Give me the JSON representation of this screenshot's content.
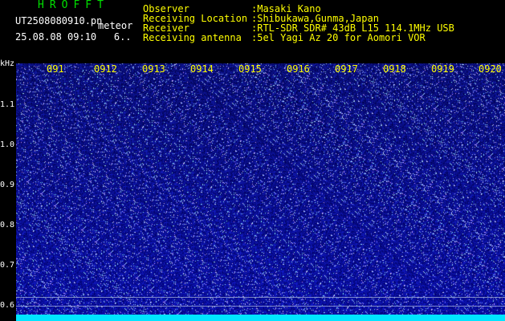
{
  "header": {
    "app_title": "HROFFT",
    "file_name": "UT2508080910.pn",
    "file_tag": "meteor",
    "timestamp": "25.08.08 09:10",
    "extra": "6.."
  },
  "station": [
    {
      "label": "Observer",
      "value": ":Masaki Kano"
    },
    {
      "label": "Receiving Location",
      "value": ":Shibukawa,Gunma,Japan"
    },
    {
      "label": "Receiver",
      "value": ":RTL-SDR SDR# 43dB L15 114.1MHz USB"
    },
    {
      "label": "Receiving antenna",
      "value": ":5el Yagi Az 20 for Aomori VOR"
    }
  ],
  "axis": {
    "y_unit": "kHz",
    "y_ticks": [
      "1.1",
      "1.0",
      "0.9",
      "0.8",
      "0.7",
      "0.6"
    ],
    "x_ticks": [
      "091",
      "0912",
      "0913",
      "0914",
      "0915",
      "0916",
      "0917",
      "0918",
      "0919",
      "0920"
    ]
  },
  "colors": {
    "background": "#000000",
    "waterfall": "#050a5e",
    "title": "#00e000",
    "meta": "#ffff00",
    "spectrum": "#00e5ff"
  }
}
